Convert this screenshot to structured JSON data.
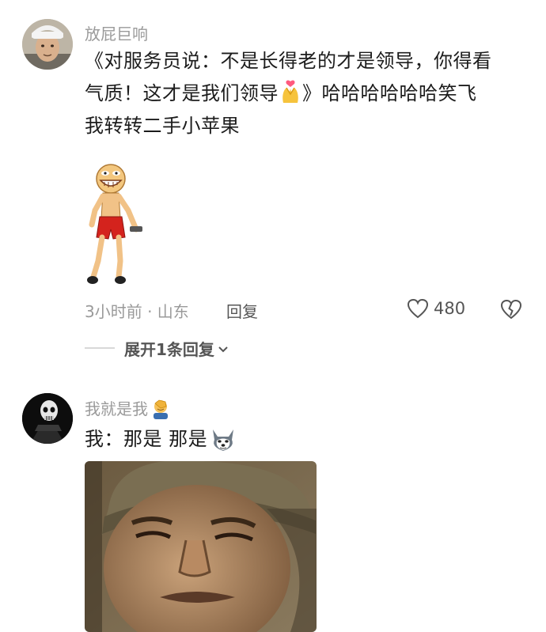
{
  "comment1": {
    "username": "放屁巨响",
    "text_line1": "《对服务员说：不是长得老的才是领导，你得看",
    "text_line2a": "气质！这才是我们领导",
    "text_line2b": "》哈哈哈哈哈哈笑飞",
    "text_line3": "我转转二手小苹果",
    "emoji_inline": "hands-heart-emoji",
    "sticker": "dancing-cartoon-sticker",
    "meta": "3小时前 · 山东",
    "reply_label": "回复",
    "like_count": "480",
    "expand_label": "展开1条回复"
  },
  "comment2": {
    "username": "我就是我",
    "username_emoji": "facepalm-emoji",
    "text": "我：那是 那是",
    "text_emoji": "husky-dog-emoji",
    "image": "soldier-smiling-photo"
  },
  "colors": {
    "muted": "#9a9a9a",
    "text": "#1c1c1c",
    "background": "#ffffff"
  }
}
